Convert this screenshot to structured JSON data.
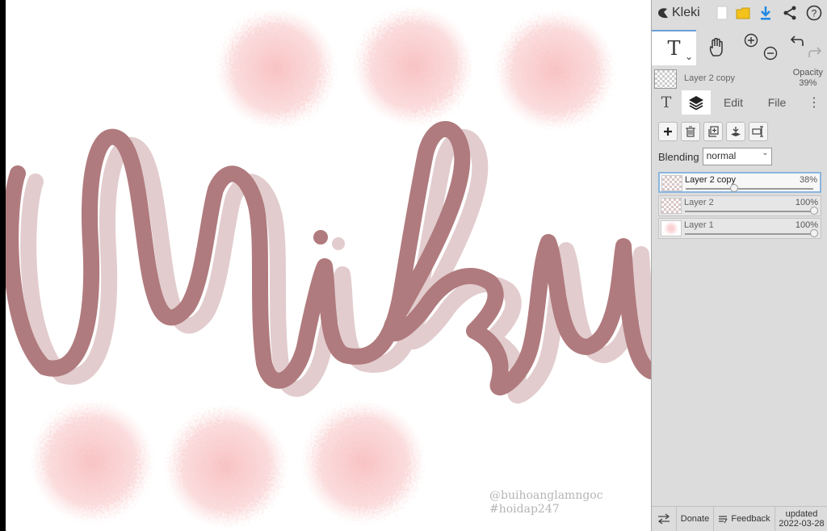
{
  "app": {
    "name": "Kleki"
  },
  "toolbar": {
    "icons": [
      "new-canvas-icon",
      "open-folder-icon",
      "download-icon",
      "share-icon",
      "help-icon"
    ]
  },
  "tools": {
    "active_tool_glyph": "T",
    "items": [
      "text-tool",
      "hand-tool",
      "zoom-in",
      "zoom-out",
      "undo",
      "redo"
    ]
  },
  "layer_info": {
    "name": "Layer 2 copy",
    "opacity_label": "Opacity",
    "opacity_value": "39%"
  },
  "tabs": {
    "text_glyph": "T",
    "edit": "Edit",
    "file": "File"
  },
  "blending": {
    "label": "Blending",
    "value": "normal"
  },
  "layers": [
    {
      "name": "Layer 2 copy",
      "opacity": "38%",
      "level": 0.38
    },
    {
      "name": "Layer 2",
      "opacity": "100%",
      "level": 1.0
    },
    {
      "name": "Layer 1",
      "opacity": "100%",
      "level": 1.0
    }
  ],
  "bottom": {
    "donate": "Donate",
    "feedback": "Feedback",
    "updated_label": "updated",
    "updated_date": "2022-03-28"
  },
  "watermark": {
    "line1": "@buihoanglamngoc",
    "line2": "#hoidap247"
  },
  "colors": {
    "stroke_dark": "#b07b7e",
    "stroke_light": "#e2ccce",
    "blob": "#f9c7c8",
    "accent": "#1e88e5"
  }
}
